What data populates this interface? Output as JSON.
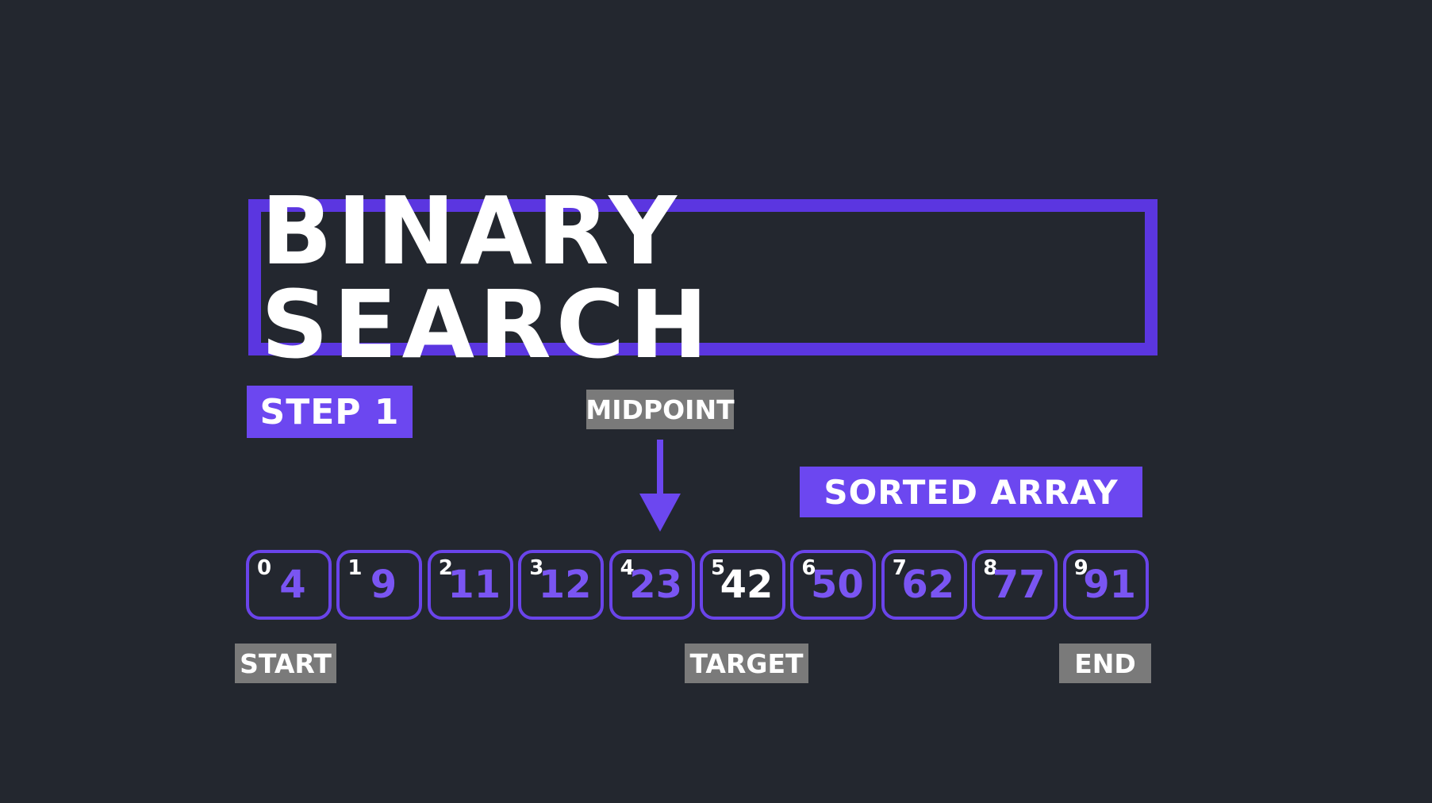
{
  "title": "Binary Search",
  "step_label": "Step 1",
  "midpoint_label": "Midpoint",
  "sorted_label": "Sorted Array",
  "start_label": "Start",
  "target_label": "Target",
  "end_label": "End",
  "cells": [
    {
      "index": "0",
      "value": "4"
    },
    {
      "index": "1",
      "value": "9"
    },
    {
      "index": "2",
      "value": "11"
    },
    {
      "index": "3",
      "value": "12"
    },
    {
      "index": "4",
      "value": "23"
    },
    {
      "index": "5",
      "value": "42",
      "target": true
    },
    {
      "index": "6",
      "value": "50"
    },
    {
      "index": "7",
      "value": "62"
    },
    {
      "index": "8",
      "value": "77"
    },
    {
      "index": "9",
      "value": "91"
    }
  ],
  "colors": {
    "background": "#23272f",
    "accent": "#5b36e0",
    "label_purple": "#6c47f0",
    "label_gray": "#7a7a7a",
    "cell_value": "#7a55f2",
    "target_value": "#ffffff"
  }
}
